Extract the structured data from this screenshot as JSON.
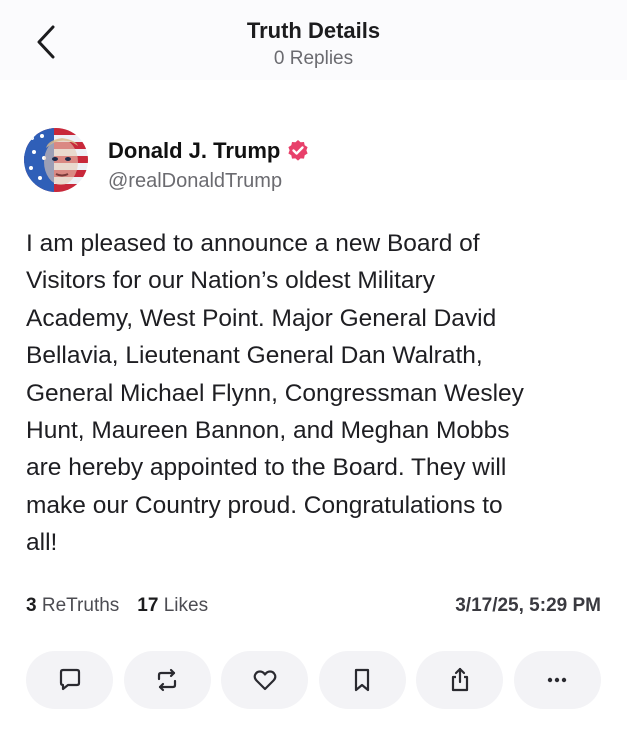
{
  "header": {
    "title": "Truth Details",
    "subtitle": "0 Replies",
    "back_icon": "chevron-left-icon"
  },
  "post": {
    "author": {
      "name": "Donald J. Trump",
      "handle": "@realDonaldTrump",
      "verified": true,
      "verified_color": "#e8406a"
    },
    "text": "I am pleased to announce a new Board of\nVisitors for our Nation’s oldest Military\nAcademy, West Point. Major General David\nBellavia, Lieutenant General Dan Walrath,\nGeneral Michael Flynn, Congressman Wesley\nHunt, Maureen Bannon, and Meghan Mobbs\nare hereby appointed to the Board. They will\nmake our Country proud. Congratulations to\nall!",
    "stats": {
      "retruths_count": "3",
      "retruths_label": "ReTruths",
      "likes_count": "17",
      "likes_label": "Likes"
    },
    "timestamp": "3/17/25, 5:29 PM"
  },
  "actions": [
    {
      "icon": "reply-icon"
    },
    {
      "icon": "retruth-icon"
    },
    {
      "icon": "heart-icon"
    },
    {
      "icon": "bookmark-icon"
    },
    {
      "icon": "share-icon"
    },
    {
      "icon": "more-icon"
    }
  ],
  "colors": {
    "header_bg": "#fbfbfd",
    "action_bg": "#f3f3f6",
    "icon": "#2a2a30",
    "verified": "#e8406a"
  }
}
